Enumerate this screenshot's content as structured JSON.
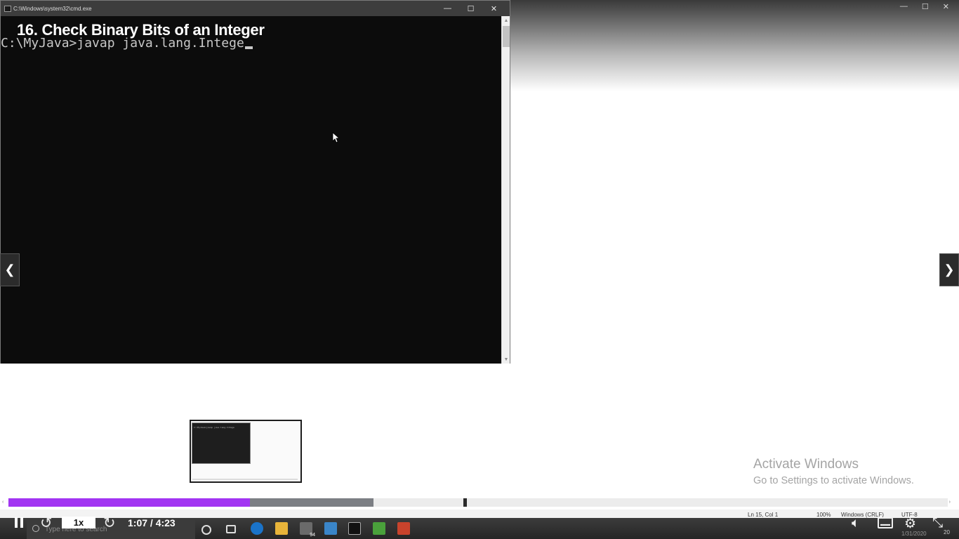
{
  "cmd_window": {
    "title": "C:\\Windows\\system32\\cmd.exe",
    "controls": {
      "minimize": "—",
      "maximize": "☐",
      "close": "✕"
    },
    "prompt_text": "C:\\MyJava>javap java.lang.Intege"
  },
  "video": {
    "title": "16. Check Binary Bits of an Integer",
    "current_time": "1:07",
    "duration": "4:23",
    "time_display": "1:07 / 4:23",
    "speed": "1x",
    "played_fraction": 0.257,
    "buffered_fraction": 0.389,
    "marker_fraction": 0.484
  },
  "navigation": {
    "prev_icon": "chevron-left-icon",
    "next_icon": "chevron-right-icon"
  },
  "watermark": {
    "title": "Activate Windows",
    "subtitle": "Go to Settings to activate Windows."
  },
  "status_bar": {
    "position": "Ln 15, Col 1",
    "zoom": "100%",
    "line_ending": "Windows (CRLF)",
    "encoding": "UTF-8"
  },
  "taskbar": {
    "search_placeholder": "Type here to search",
    "mail_badge": "94",
    "date": "1/31/2020",
    "notification_count": "20"
  },
  "colors": {
    "progress_played": "#a235f2",
    "progress_buffered": "#7c7f84",
    "terminal_bg": "#0c0c0c"
  }
}
